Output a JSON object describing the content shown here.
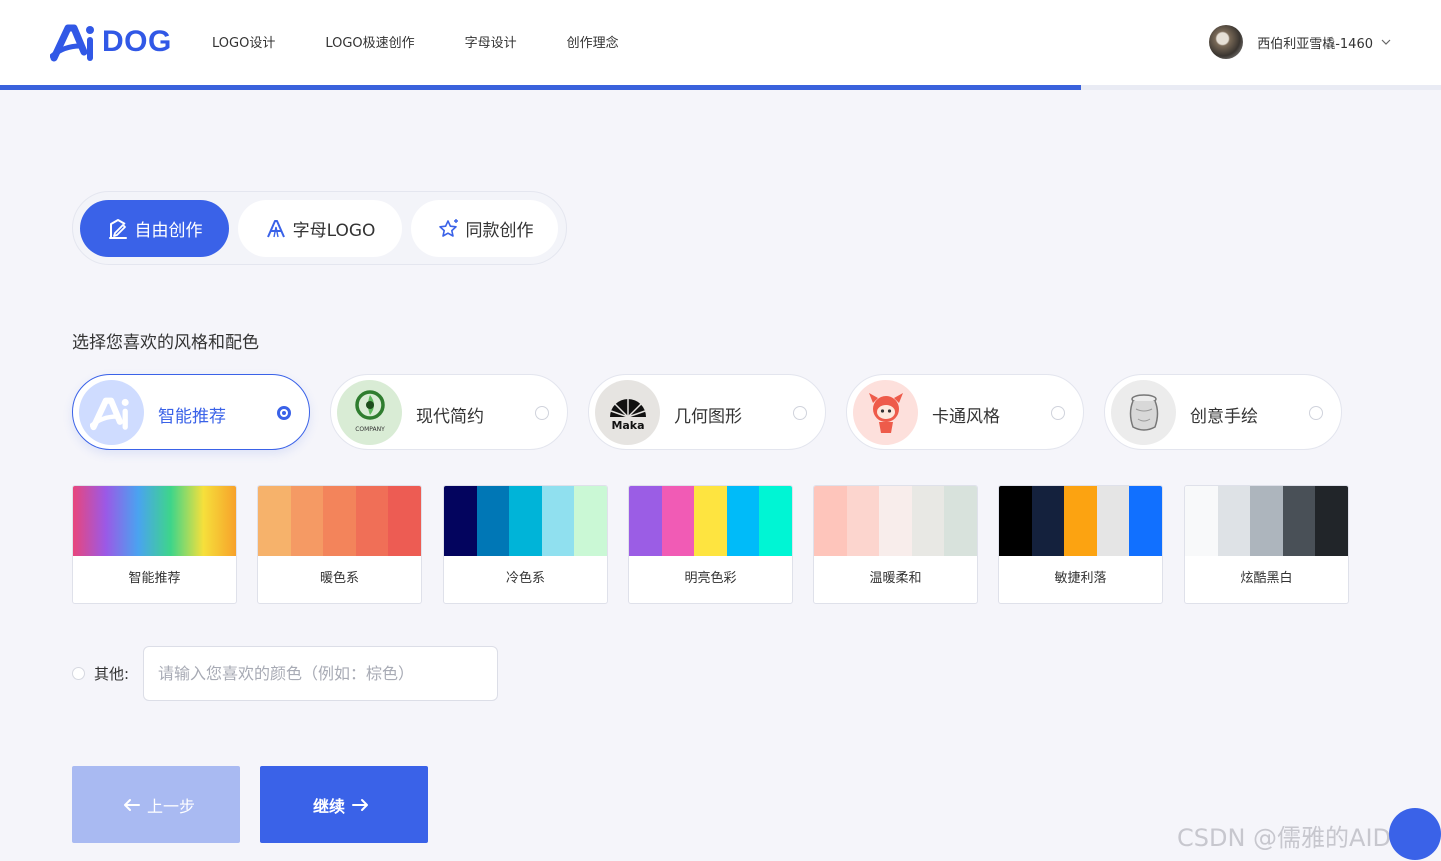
{
  "header": {
    "logo_text": "DOG",
    "nav": [
      "LOGO设计",
      "LOGO极速创作",
      "字母设计",
      "创作理念"
    ],
    "user_name": "西伯利亚雪橇-1460",
    "progress_fraction": 0.75
  },
  "modes": {
    "tabs": [
      "自由创作",
      "字母LOGO",
      "同款创作"
    ],
    "active": "自由创作"
  },
  "section_title": "选择您喜欢的风格和配色",
  "styles": {
    "items": [
      "智能推荐",
      "现代简约",
      "几何图形",
      "卡通风格",
      "创意手绘"
    ],
    "selected": "智能推荐",
    "thumb_texts": {
      "modern": "COMPANY",
      "geometric": "Maka"
    }
  },
  "palettes": [
    {
      "name": "智能推荐",
      "colors": [
        "#e8467c",
        "#9b59e6",
        "#4aa3f0",
        "#3ed58a",
        "#f6e03b",
        "#f7a12a"
      ]
    },
    {
      "name": "暖色系",
      "colors": [
        "#f6b26b",
        "#f59a64",
        "#f3845b",
        "#f06f57",
        "#ed5c53"
      ]
    },
    {
      "name": "冷色系",
      "colors": [
        "#03045e",
        "#0077b6",
        "#00b4d8",
        "#90e0ef",
        "#caf8d5"
      ]
    },
    {
      "name": "明亮色彩",
      "colors": [
        "#9b5de5",
        "#f15bb5",
        "#fee440",
        "#00bbf9",
        "#00f5d4"
      ]
    },
    {
      "name": "温暖柔和",
      "colors": [
        "#fec5bb",
        "#fcd5ce",
        "#f8edeb",
        "#e8e8e4",
        "#d8e2dc"
      ]
    },
    {
      "name": "敏捷利落",
      "colors": [
        "#000000",
        "#14213d",
        "#fca311",
        "#e5e5e5",
        "#1170ff"
      ]
    },
    {
      "name": "炫酷黑白",
      "colors": [
        "#f8f9fa",
        "#dee2e6",
        "#adb5bd",
        "#495057",
        "#212529"
      ]
    }
  ],
  "other": {
    "label": "其他:",
    "placeholder": "请输入您喜欢的颜色（例如：棕色）"
  },
  "buttons": {
    "prev": "上一步",
    "next": "继续"
  },
  "watermark": "CSDN @儒雅的AIDOG"
}
